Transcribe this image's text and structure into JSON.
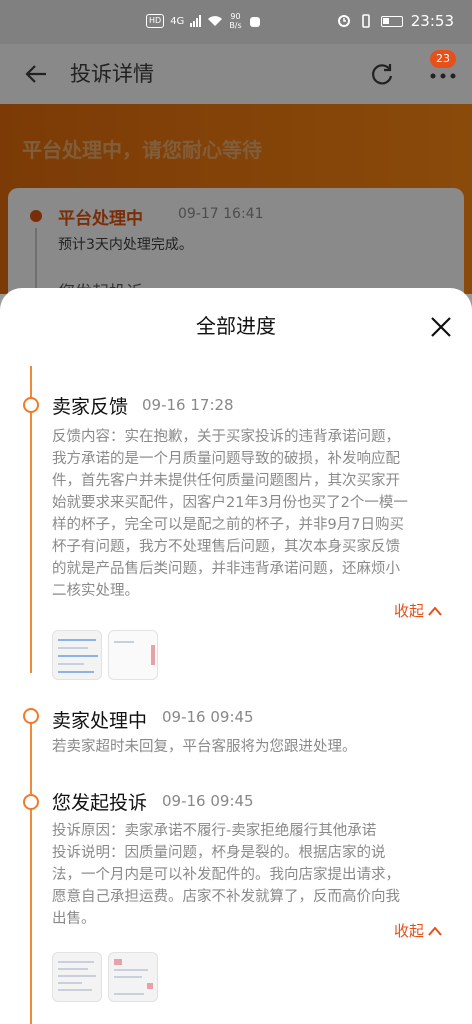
{
  "status_bar": {
    "hd": "HD",
    "network": "4G",
    "speed_top": "90",
    "speed_bottom": "B/s",
    "time": "23:53"
  },
  "header": {
    "title": "投诉详情",
    "badge": "23"
  },
  "banner": {
    "title": "平台处理中，请您耐心等待",
    "card": {
      "title": "平台处理中",
      "time": "09-17 16:41",
      "desc": "预计3天内处理完成。",
      "cut_text": "您发起投诉"
    }
  },
  "sheet": {
    "title": "全部进度",
    "events": [
      {
        "title": "卖家反馈",
        "time": "09-16 17:28",
        "lines": [
          "反馈内容：实在抱歉，关于买家投诉的违背承诺问题，",
          "我方承诺的是一个月质量问题导致的破损，补发响应配",
          "件，首先客户并未提供任何质量问题图片，其次买家开",
          "始就要求来买配件，因客户21年3月份也买了2个一模一",
          "样的杯子，完全可以是配之前的杯子，并非9月7日购买",
          "杯子有问题，我方不处理售后问题，其次本身买家反馈",
          "的就是产品售后类问题，并非违背承诺问题，还麻烦小",
          "二核实处理。"
        ],
        "collapse": "收起"
      },
      {
        "title": "卖家处理中",
        "time": "09-16 09:45",
        "lines": [
          "若卖家超时未回复，平台客服将为您跟进处理。"
        ]
      },
      {
        "title": "您发起投诉",
        "time": "09-16 09:45",
        "lines": [
          "投诉原因：卖家承诺不履行-卖家拒绝履行其他承诺",
          "投诉说明：因质量问题，杯身是裂的。根据店家的说",
          "法，一个月内是可以补发配件的。我向店家提出请求，",
          "愿意自己承担运费。店家不补发就算了，反而高价向我",
          "出售。"
        ],
        "collapse": "收起"
      }
    ]
  },
  "colors": {
    "accent": "#e8501a",
    "timeline": "#f08a3a"
  },
  "icons": [
    "back-icon",
    "refresh-icon",
    "more-icon",
    "close-icon",
    "chevron-up-icon"
  ]
}
